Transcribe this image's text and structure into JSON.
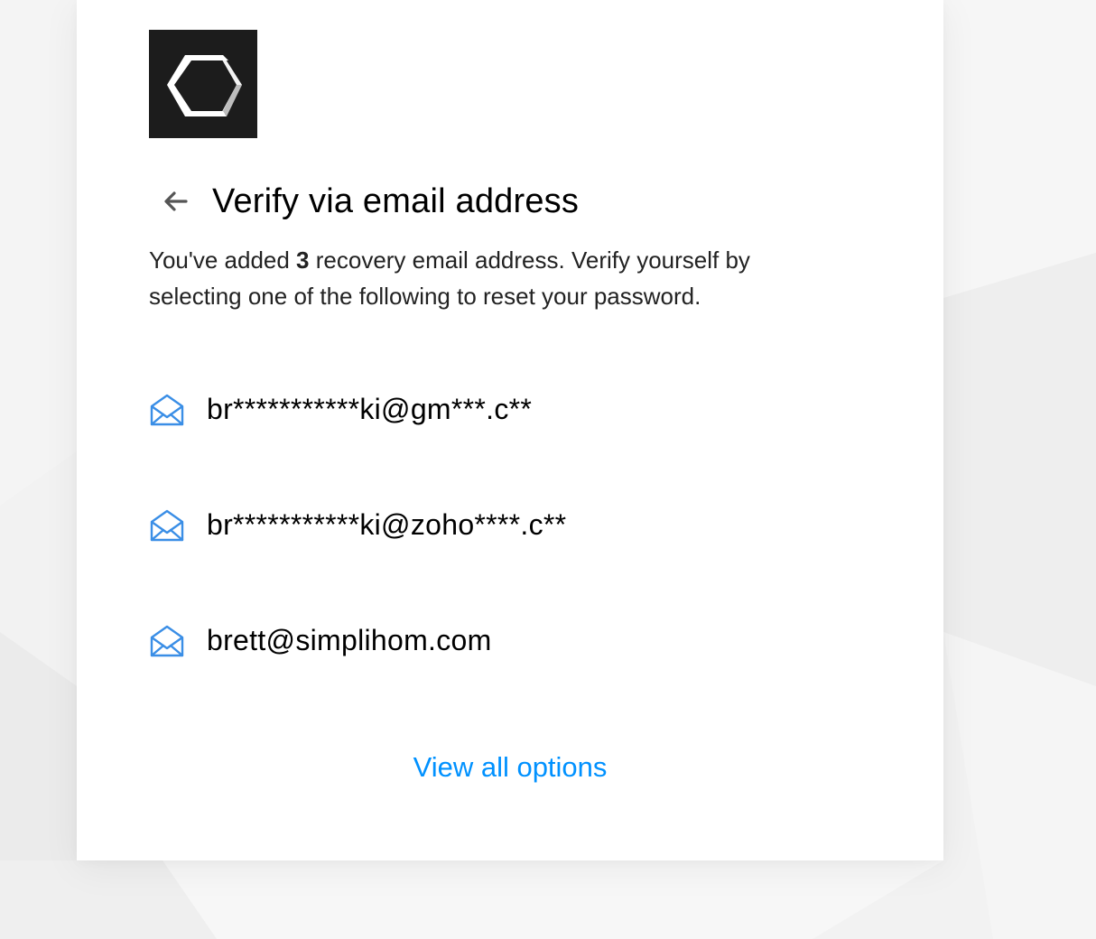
{
  "page": {
    "background_color": "#f3f3f3",
    "card_color": "#ffffff"
  },
  "logo": {
    "icon": "hexagon-logo-icon",
    "background": "#1c1c1c"
  },
  "header": {
    "back_icon": "arrow-left-icon",
    "title": "Verify via email address"
  },
  "description": {
    "prefix": "You've added ",
    "count": "3",
    "suffix": " recovery email address. Verify yourself by selecting one of the following to reset your password."
  },
  "emails": [
    {
      "icon": "envelope-open-icon",
      "address": "br***********ki@gm***.c**"
    },
    {
      "icon": "envelope-open-icon",
      "address": "br***********ki@zoho****.c**"
    },
    {
      "icon": "envelope-open-icon",
      "address": "brett@simplihom.com"
    }
  ],
  "footer": {
    "view_all_label": "View all options",
    "link_color": "#0091ff",
    "icon_color": "#3a8ee6"
  }
}
